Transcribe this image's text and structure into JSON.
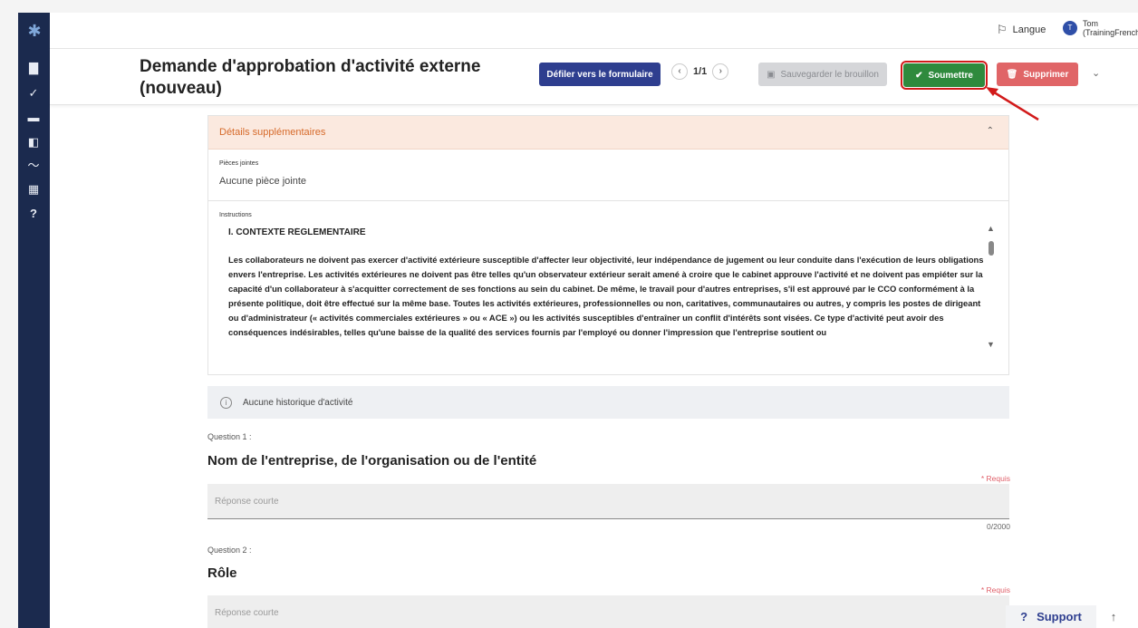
{
  "topbar": {
    "language_label": "Langue",
    "user_initial": "T",
    "user_name_line1": "Tom",
    "user_name_line2": "(TrainingFrench"
  },
  "header": {
    "title": "Demande d'approbation d'activité externe (nouveau)",
    "scroll_button": "Défiler vers le formulaire",
    "pager": "1/1",
    "draft_button": "Sauvegarder le brouillon",
    "submit_button": "Soumettre",
    "delete_button": "Supprimer"
  },
  "details": {
    "section_title": "Détails supplémentaires",
    "attachments_label": "Pièces jointes",
    "attachments_value": "Aucune pièce jointe",
    "instructions_label": "Instructions",
    "instructions_heading": "I. CONTEXTE RÉGLEMENTAIRE",
    "instructions_text": "Les collaborateurs ne doivent pas exercer d'activité extérieure susceptible d'affecter leur objectivité, leur indépendance de jugement ou leur conduite dans l'exécution de leurs obligations envers l'entreprise. Les activités extérieures ne doivent pas être telles qu'un observateur extérieur serait amené à croire que le cabinet approuve l'activité et ne doivent pas empiéter sur la capacité d'un collaborateur à s'acquitter correctement de ses fonctions au sein du cabinet. De même, le travail pour d'autres entreprises, s'il est approuvé par le CCO conformément à la présente politique, doit être effectué sur la même base. Toutes les activités extérieures, professionnelles ou non, caritatives, communautaires ou autres, y compris les postes de dirigeant ou d'administrateur (« activités commerciales extérieures » ou « ACE ») ou les activités susceptibles d'entraîner un conflit d'intérêts sont visées. Ce type d'activité peut avoir des conséquences indésirables, telles qu'une baisse de la qualité des services fournis par l'employé ou donner l'impression que l'entreprise soutient ou"
  },
  "history": {
    "text": "Aucune historique d'activité"
  },
  "questions": [
    {
      "number": "Question 1 :",
      "title": "Nom de l'entreprise, de l'organisation ou de l'entité",
      "required": "* Requis",
      "placeholder": "Réponse courte",
      "counter": "0/2000"
    },
    {
      "number": "Question 2 :",
      "title": "Rôle",
      "required": "* Requis",
      "placeholder": "Réponse courte"
    }
  ],
  "footer": {
    "support_label": "Support"
  },
  "icons": {
    "sidebar": [
      "dashboard-icon",
      "check-circle-icon",
      "chat-icon",
      "library-icon",
      "trend-icon",
      "building-icon",
      "help-icon"
    ],
    "accent_color": "#2e3e8f",
    "submit_color": "#2f8a3d",
    "delete_color": "#e06567",
    "annotation_color": "#d21a1a"
  }
}
